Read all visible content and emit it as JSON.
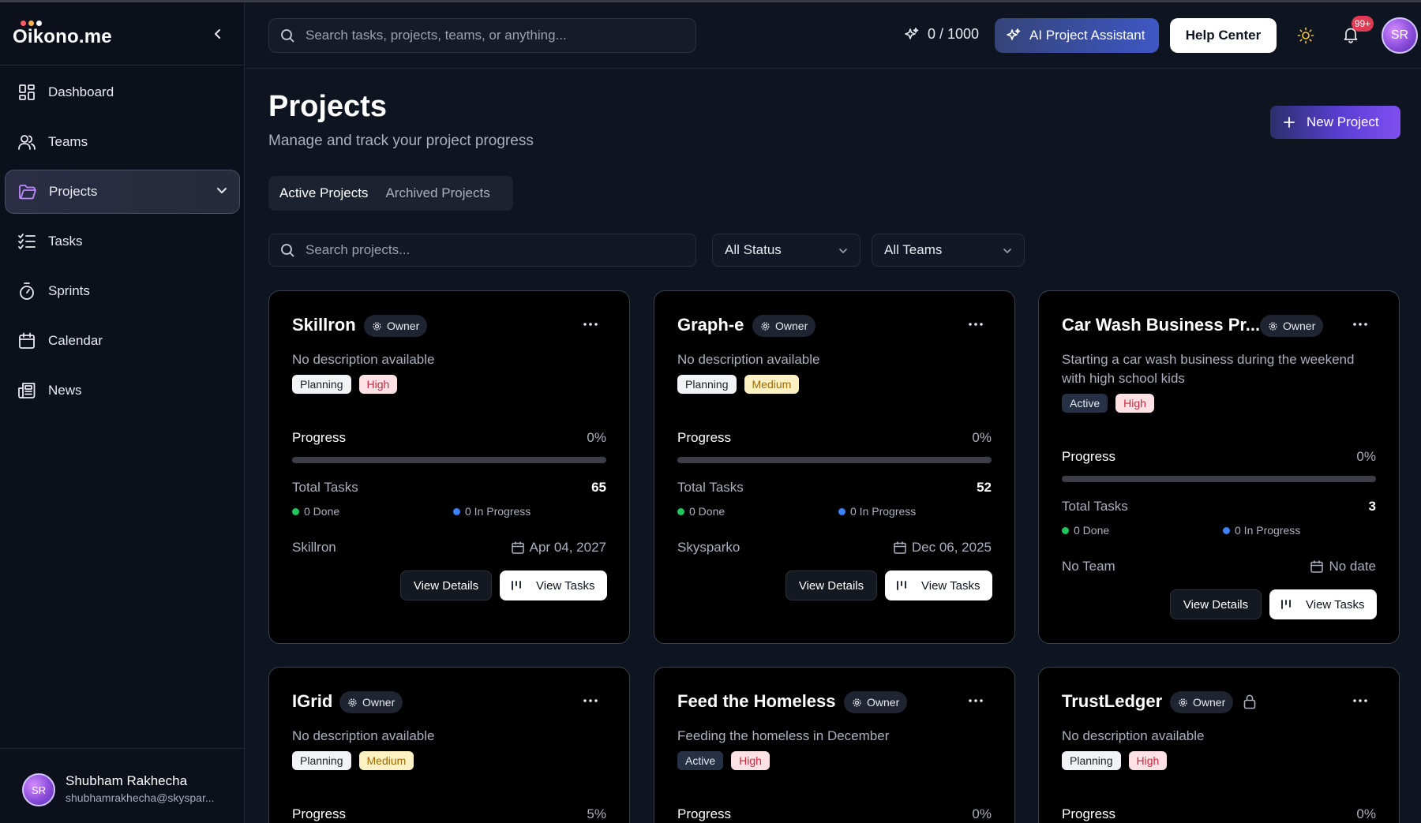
{
  "brand": {
    "name": "Oikono.me",
    "dot_colors": [
      "#ff5a6a",
      "#ffb44a",
      "#ffffff"
    ]
  },
  "sidebar": {
    "items": [
      {
        "label": "Dashboard",
        "icon": "dashboard-icon"
      },
      {
        "label": "Teams",
        "icon": "users-icon"
      },
      {
        "label": "Projects",
        "icon": "folder-icon",
        "active": true
      },
      {
        "label": "Tasks",
        "icon": "list-check-icon"
      },
      {
        "label": "Sprints",
        "icon": "timer-icon"
      },
      {
        "label": "Calendar",
        "icon": "calendar-icon"
      },
      {
        "label": "News",
        "icon": "newspaper-icon"
      }
    ],
    "user": {
      "initials": "SR",
      "name": "Shubham Rakhecha",
      "email": "shubhamrakhecha@skyspar..."
    }
  },
  "topbar": {
    "search_placeholder": "Search tasks, projects, teams, or anything...",
    "credits": "0 / 1000",
    "ai_button": "AI Project Assistant",
    "help_button": "Help Center",
    "notifications_badge": "99+",
    "avatar_initials": "SR"
  },
  "main": {
    "title": "Projects",
    "subtitle": "Manage and track your project progress",
    "new_project_button": "New Project",
    "tabs": [
      {
        "label": "Active Projects",
        "active": true
      },
      {
        "label": "Archived Projects",
        "active": false
      }
    ],
    "project_search_placeholder": "Search projects...",
    "status_filter": "All Status",
    "team_filter": "All Teams"
  },
  "common": {
    "owner": "Owner",
    "progress": "Progress",
    "total_tasks": "Total Tasks",
    "view_details": "View Details",
    "view_tasks": "View Tasks"
  },
  "projects": [
    {
      "name": "Skillron",
      "description": "No description available",
      "status": "Planning",
      "priority": "High",
      "progress_label": "0%",
      "progress_fraction": 0,
      "total_tasks": "65",
      "done": "0 Done",
      "in_progress": "0 In Progress",
      "team": "Skillron",
      "due": "Apr 04, 2027"
    },
    {
      "name": "Graph-e",
      "description": "No description available",
      "status": "Planning",
      "priority": "Medium",
      "progress_label": "0%",
      "progress_fraction": 0,
      "total_tasks": "52",
      "done": "0 Done",
      "in_progress": "0 In Progress",
      "team": "Skysparko",
      "due": "Dec 06, 2025"
    },
    {
      "name": "Car Wash Business Pr...",
      "description": "Starting a car wash business during the weekend with high school kids",
      "status": "Active",
      "priority": "High",
      "progress_label": "0%",
      "progress_fraction": 0,
      "total_tasks": "3",
      "done": "0 Done",
      "in_progress": "0 In Progress",
      "team": "No Team",
      "due": "No date"
    },
    {
      "name": "IGrid",
      "description": "No description available",
      "status": "Planning",
      "priority": "Medium",
      "progress_label": "5%",
      "progress_fraction": 0.05
    },
    {
      "name": "Feed the Homeless",
      "description": "Feeding the homeless in December",
      "status": "Active",
      "priority": "High",
      "progress_label": "0%",
      "progress_fraction": 0
    },
    {
      "name": "TrustLedger",
      "description": "No description available",
      "status": "Planning",
      "priority": "High",
      "progress_label": "0%",
      "progress_fraction": 0,
      "locked": true
    }
  ],
  "colors": {
    "done": "#22c55e",
    "in_progress": "#3b82f6",
    "accent": "#6b4cf0"
  }
}
